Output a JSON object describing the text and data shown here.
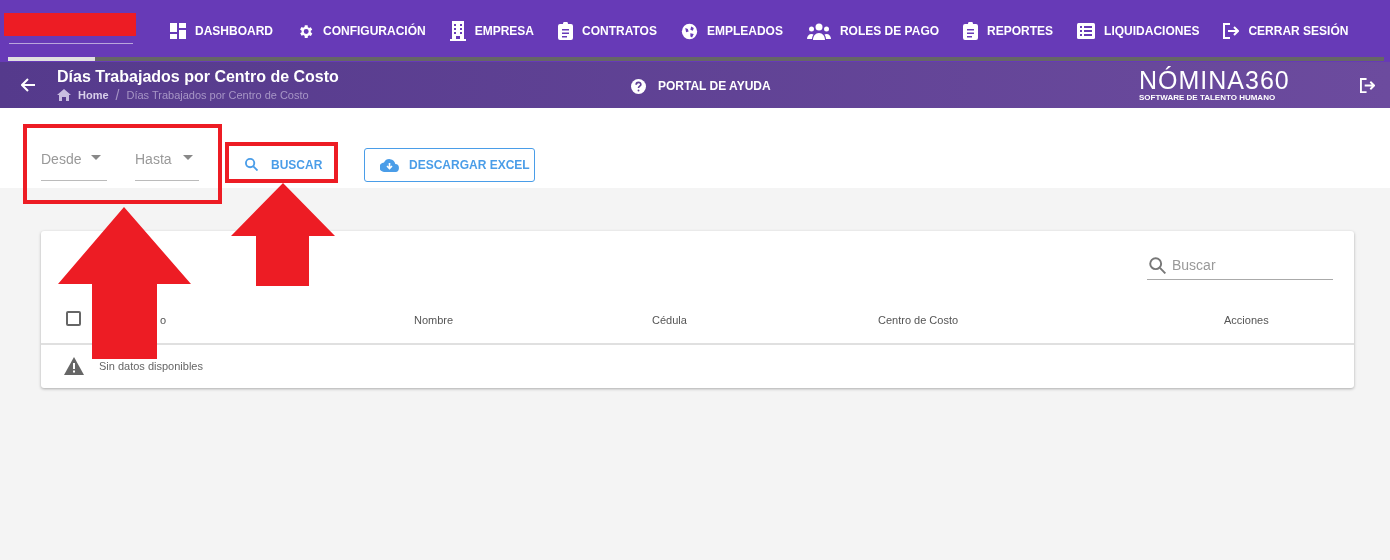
{
  "nav": {
    "progress": {
      "level": 0.063
    },
    "items": [
      {
        "label": "DASHBOARD",
        "kind": "dashboard"
      },
      {
        "label": "CONFIGURACIÓN",
        "kind": "gear"
      },
      {
        "label": "EMPRESA",
        "kind": "building"
      },
      {
        "label": "CONTRATOS",
        "kind": "clipboard"
      },
      {
        "label": "EMPLEADOS",
        "kind": "globe"
      },
      {
        "label": "ROLES DE PAGO",
        "kind": "people"
      },
      {
        "label": "REPORTES",
        "kind": "clipboard"
      },
      {
        "label": "LIQUIDACIONES",
        "kind": "list"
      },
      {
        "label": "CERRAR SESIÓN",
        "kind": "logout"
      }
    ]
  },
  "header": {
    "title": "Días Trabajados por Centro de Costo",
    "breadcrumb": [
      "Home",
      "/",
      "Días Trabajados por Centro de Costo"
    ],
    "help": "PORTAL DE AYUDA",
    "logo": "NÓMINA360",
    "logo_tagline": "SOFTWARE DE TALENTO HUMANO"
  },
  "filters": {
    "from": {
      "placeholder": "Desde"
    },
    "to": {
      "placeholder": "Hasta"
    },
    "search_button": "BUSCAR",
    "excel_button": "DESCARGAR EXCEL"
  },
  "table": {
    "search": {
      "placeholder": "Buscar"
    },
    "select_all": {
      "checked": false
    },
    "columns": [
      "o",
      "Nombre",
      "Cédula",
      "Centro de Costo",
      "Acciones"
    ],
    "empty_message": "Sin datos disponibles"
  }
}
